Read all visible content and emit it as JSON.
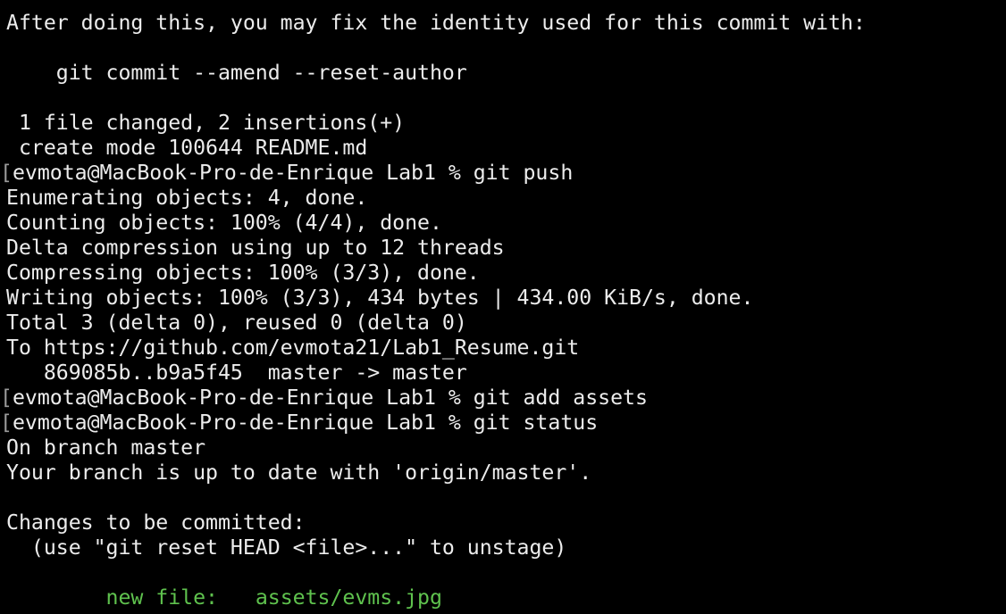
{
  "terminal": {
    "lines": [
      {
        "id": 0,
        "text": "After doing this, you may fix the identity used for this commit with:"
      },
      {
        "id": 1,
        "text": ""
      },
      {
        "id": 2,
        "text": "    git commit --amend --reset-author"
      },
      {
        "id": 3,
        "text": ""
      },
      {
        "id": 4,
        "text": " 1 file changed, 2 insertions(+)"
      },
      {
        "id": 5,
        "text": " create mode 100644 README.md"
      },
      {
        "id": 6,
        "text": "evmota@MacBook-Pro-de-Enrique Lab1 % git push"
      },
      {
        "id": 7,
        "text": "Enumerating objects: 4, done."
      },
      {
        "id": 8,
        "text": "Counting objects: 100% (4/4), done."
      },
      {
        "id": 9,
        "text": "Delta compression using up to 12 threads"
      },
      {
        "id": 10,
        "text": "Compressing objects: 100% (3/3), done."
      },
      {
        "id": 11,
        "text": "Writing objects: 100% (3/3), 434 bytes | 434.00 KiB/s, done."
      },
      {
        "id": 12,
        "text": "Total 3 (delta 0), reused 0 (delta 0)"
      },
      {
        "id": 13,
        "text": "To https://github.com/evmota21/Lab1_Resume.git"
      },
      {
        "id": 14,
        "text": "   869085b..b9a5f45  master -> master"
      },
      {
        "id": 15,
        "text": "evmota@MacBook-Pro-de-Enrique Lab1 % git add assets"
      },
      {
        "id": 16,
        "text": "evmota@MacBook-Pro-de-Enrique Lab1 % git status"
      },
      {
        "id": 17,
        "text": "On branch master"
      },
      {
        "id": 18,
        "text": "Your branch is up to date with 'origin/master'."
      },
      {
        "id": 19,
        "text": ""
      },
      {
        "id": 20,
        "text": "Changes to be committed:"
      },
      {
        "id": 21,
        "text": "  (use \"git reset HEAD <file>...\" to unstage)"
      },
      {
        "id": 22,
        "text": ""
      },
      {
        "id": 23,
        "label": "        new file:   ",
        "path": "assets/evms.jpg"
      }
    ],
    "prompt_marker": "[",
    "colors": {
      "background": "#000000",
      "foreground": "#ececec",
      "staged_file": "#5fc24e",
      "prompt_marker": "#9a9a9a"
    }
  }
}
